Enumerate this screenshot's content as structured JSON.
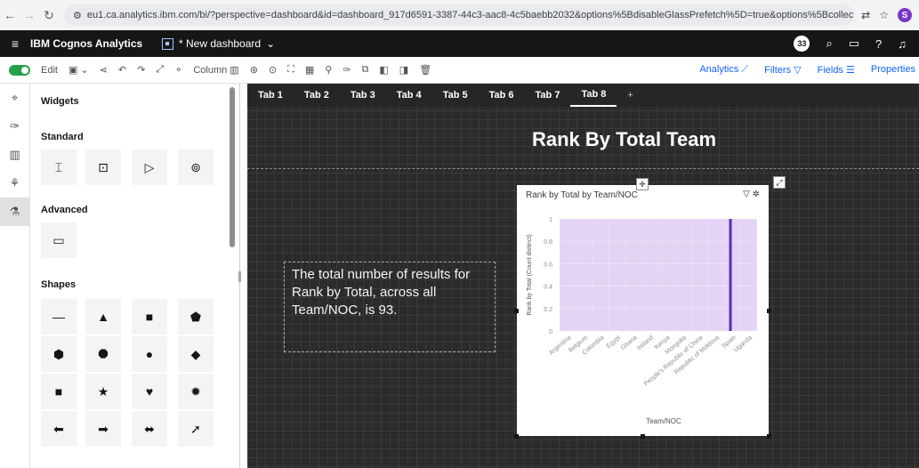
{
  "browser": {
    "url": "eu1.ca.analytics.ibm.com/bi/?perspective=dashboard&id=dashboard_917d6591-3387-44c3-aac8-4c5baebb2032&options%5BdisableGlassPrefetch%5D=true&options%5Bcollections%5D%5Bcanv...",
    "profile_initial": "S"
  },
  "app": {
    "brand": "IBM Cognos Analytics",
    "dashboard_name": "* New dashboard",
    "notification_count": "33"
  },
  "toolbar": {
    "edit_label": "Edit",
    "column_label": "Column",
    "analytics_label": "Analytics",
    "filters_label": "Filters",
    "fields_label": "Fields",
    "properties_label": "Properties"
  },
  "panel": {
    "title": "Widgets",
    "standard": "Standard",
    "advanced": "Advanced",
    "shapes": "Shapes"
  },
  "tabs": [
    "Tab 1",
    "Tab 2",
    "Tab 3",
    "Tab 4",
    "Tab 5",
    "Tab 6",
    "Tab 7",
    "Tab 8",
    "+"
  ],
  "canvas": {
    "title": "Rank By Total Team",
    "summary": "The total number of results for Rank by Total, across all Team/NOC, is 93."
  },
  "viz_title": "Rank by Total by Team/NOC",
  "chart_data": {
    "type": "bar",
    "title": "Rank by Total by Team/NOC",
    "xlabel": "Team/NOC",
    "ylabel": "Rank by Total (Count distinct)",
    "ylim": [
      0,
      1
    ],
    "yticks": [
      "0",
      "0.2",
      "0.4",
      "0.6",
      "0.8",
      "1"
    ],
    "categories": [
      "Argentina",
      "Belgium",
      "Colombia",
      "Egypt",
      "Ghana",
      "Ireland",
      "Kenya",
      "Mongolia",
      "People's Republic of China",
      "Republic of Moldova",
      "Spain",
      "Uganda"
    ],
    "values": [
      1,
      1,
      1,
      1,
      1,
      1,
      1,
      1,
      1,
      1,
      1,
      1
    ],
    "bar_color": "#d9c4f2",
    "highlight_color": "#5b2fb3"
  }
}
